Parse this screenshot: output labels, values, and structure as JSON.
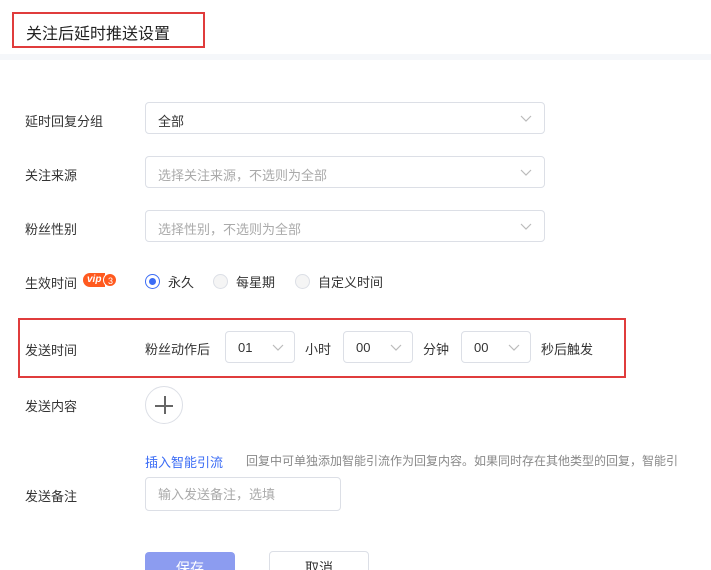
{
  "header": {
    "title": "关注后延时推送设置"
  },
  "form": {
    "reply_group": {
      "label": "延时回复分组",
      "value": "全部"
    },
    "follow_source": {
      "label": "关注来源",
      "placeholder": "选择关注来源，不选则为全部"
    },
    "fan_gender": {
      "label": "粉丝性别",
      "placeholder": "选择性别，不选则为全部"
    },
    "effective_time": {
      "label": "生效时间",
      "vip_badge": "vip",
      "vip_level": "3",
      "options": [
        "永久",
        "每星期",
        "自定义时间"
      ],
      "selected": "永久"
    },
    "send_time": {
      "label": "发送时间",
      "prefix": "粉丝动作后",
      "hours_value": "01",
      "hours_unit": "小时",
      "minutes_value": "00",
      "minutes_unit": "分钟",
      "seconds_value": "00",
      "suffix": "秒后触发"
    },
    "send_content": {
      "label": "发送内容",
      "insert_link": "插入智能引流",
      "hint": "回复中可单独添加智能引流作为回复内容。如果同时存在其他类型的回复，智能引"
    },
    "send_remark": {
      "label": "发送备注",
      "placeholder": "输入发送备注，选填"
    }
  },
  "actions": {
    "save": "保存",
    "cancel": "取消"
  },
  "colors": {
    "accent": "#3b6cf5",
    "highlight_border": "#e03c3c",
    "vip": "#ff5a1f"
  }
}
